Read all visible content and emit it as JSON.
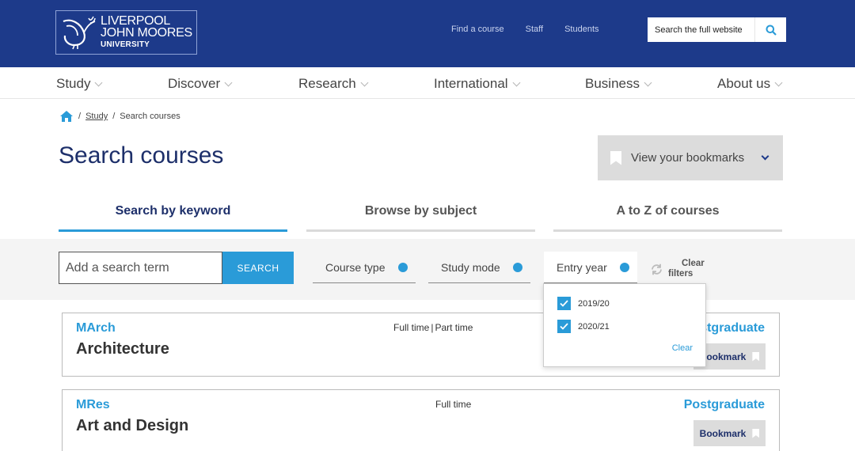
{
  "brand": {
    "line1": "LIVERPOOL",
    "line2": "JOHN MOORES",
    "line3": "UNIVERSITY"
  },
  "top_links": [
    "Find a course",
    "Staff",
    "Students"
  ],
  "site_search": {
    "placeholder": "Search the full website"
  },
  "nav": [
    "Study",
    "Discover",
    "Research",
    "International",
    "Business",
    "About us"
  ],
  "breadcrumb": {
    "sep": "/",
    "items": [
      "Study",
      "Search courses"
    ]
  },
  "page_title": "Search courses",
  "bookmarks_label": "View your bookmarks",
  "tabs": [
    "Search by keyword",
    "Browse by subject",
    "A to Z of courses"
  ],
  "search": {
    "placeholder": "Add a search term",
    "button": "SEARCH"
  },
  "filters": [
    "Course type",
    "Study mode",
    "Entry year"
  ],
  "clear_filters": {
    "line1": "Clear",
    "line2": "filters"
  },
  "entry_year_dropdown": {
    "options": [
      "2019/20",
      "2020/21"
    ],
    "clear": "Clear"
  },
  "courses": [
    {
      "award": "MArch",
      "name": "Architecture",
      "mode_a": "Full time",
      "mode_sep": "|",
      "mode_b": "Part time",
      "level": "Postgraduate",
      "bookmark": "Bookmark"
    },
    {
      "award": "MRes",
      "name": "Art and Design",
      "mode": "Full time",
      "level": "Postgraduate",
      "bookmark": "Bookmark"
    }
  ],
  "colors": {
    "header": "#1d3a8a",
    "accent": "#2a9bd8",
    "title": "#1d2f6a"
  }
}
